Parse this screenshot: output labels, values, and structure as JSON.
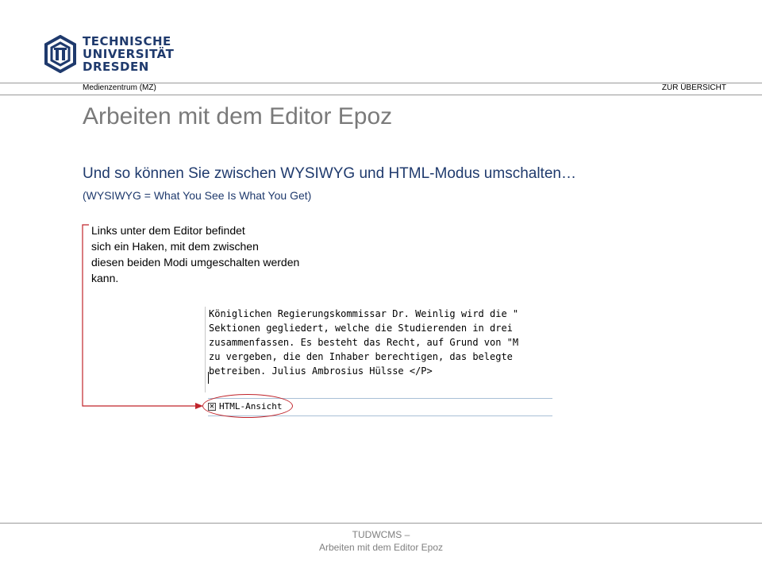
{
  "header": {
    "logo_lines": [
      "TECHNISCHE",
      "UNIVERSITÄT",
      "DRESDEN"
    ],
    "department": "Medienzentrum (MZ)",
    "overview_link": "ZUR ÜBERSICHT"
  },
  "slide": {
    "title": "Arbeiten mit dem Editor Epoz",
    "subtitle": "Und so können Sie zwischen WYSIWYG und HTML-Modus umschalten…",
    "note": "(WYSIWYG = What You See Is What You Get)",
    "callout_lines": [
      "Links unter dem Editor befindet",
      "sich ein Haken, mit dem zwischen",
      "diesen beiden Modi umgeschalten werden",
      "kann."
    ]
  },
  "editor": {
    "lines": [
      "Königlichen Regierungskommissar Dr. Weinlig wird die \"",
      "Sektionen gegliedert, welche die Studierenden in drei",
      "zusammenfassen. Es besteht das Recht, auf Grund von \"M",
      "zu vergeben, die den Inhaber berechtigen, das belegte",
      "betreiben. Julius Ambrosius Hülsse </P>"
    ],
    "html_toggle_label": "HTML-Ansicht",
    "html_toggle_checked": true
  },
  "footer": {
    "line1": "TUDWCMS –",
    "line2": "Arbeiten mit dem Editor Epoz"
  },
  "colors": {
    "title": "#7a7a7a",
    "accent": "#1f3a6d",
    "highlight": "#c0242b"
  }
}
